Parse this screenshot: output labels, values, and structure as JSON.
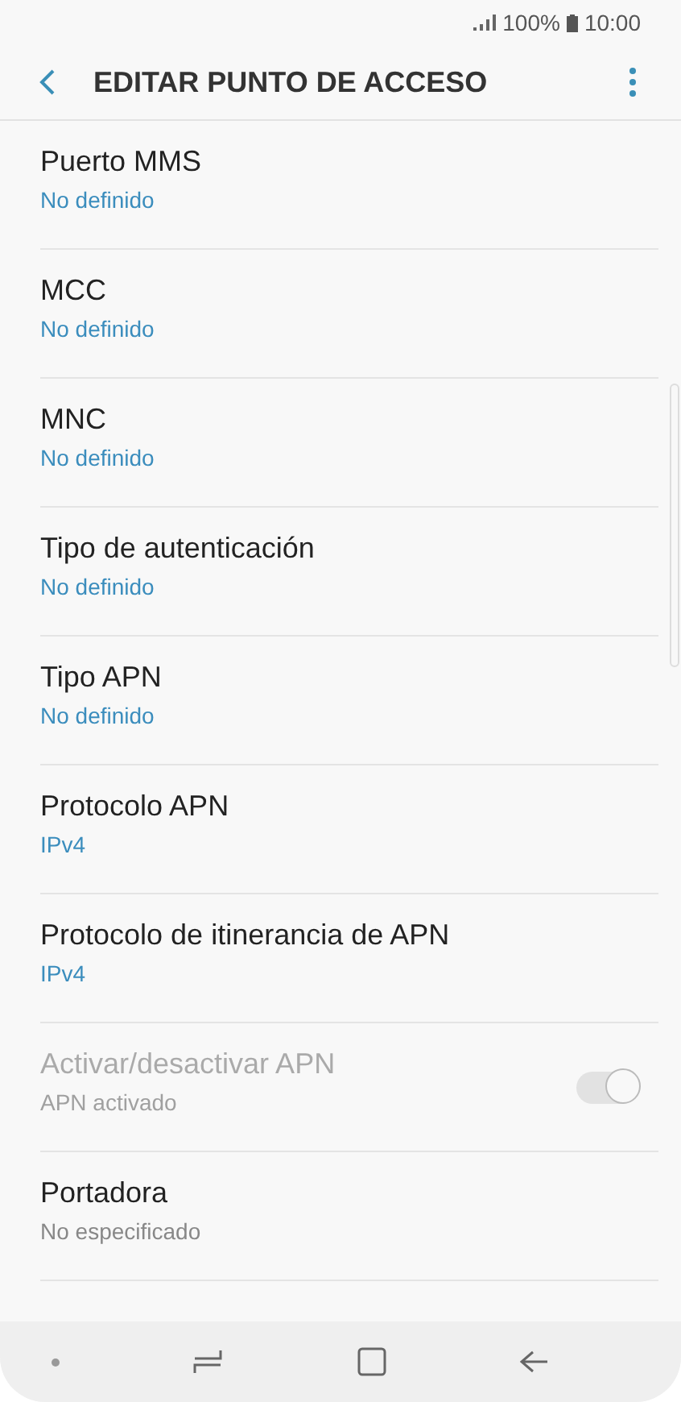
{
  "status_bar": {
    "battery": "100%",
    "time": "10:00"
  },
  "header": {
    "title": "EDITAR PUNTO DE ACCESO"
  },
  "settings": [
    {
      "title": "Puerto MMS",
      "value": "No definido",
      "kind": "accent",
      "disabled": false
    },
    {
      "title": "MCC",
      "value": "No definido",
      "kind": "accent",
      "disabled": false
    },
    {
      "title": "MNC",
      "value": "No definido",
      "kind": "accent",
      "disabled": false
    },
    {
      "title": "Tipo de autenticación",
      "value": "No definido",
      "kind": "accent",
      "disabled": false
    },
    {
      "title": "Tipo APN",
      "value": "No definido",
      "kind": "accent",
      "disabled": false
    },
    {
      "title": "Protocolo APN",
      "value": "IPv4",
      "kind": "accent",
      "disabled": false
    },
    {
      "title": "Protocolo de itinerancia de APN",
      "value": "IPv4",
      "kind": "accent",
      "disabled": false
    },
    {
      "title": "Activar/desactivar APN",
      "value": "APN activado",
      "kind": "toggle",
      "disabled": true,
      "on": true
    },
    {
      "title": "Portadora",
      "value": "No especificado",
      "kind": "plain",
      "disabled": false
    }
  ]
}
